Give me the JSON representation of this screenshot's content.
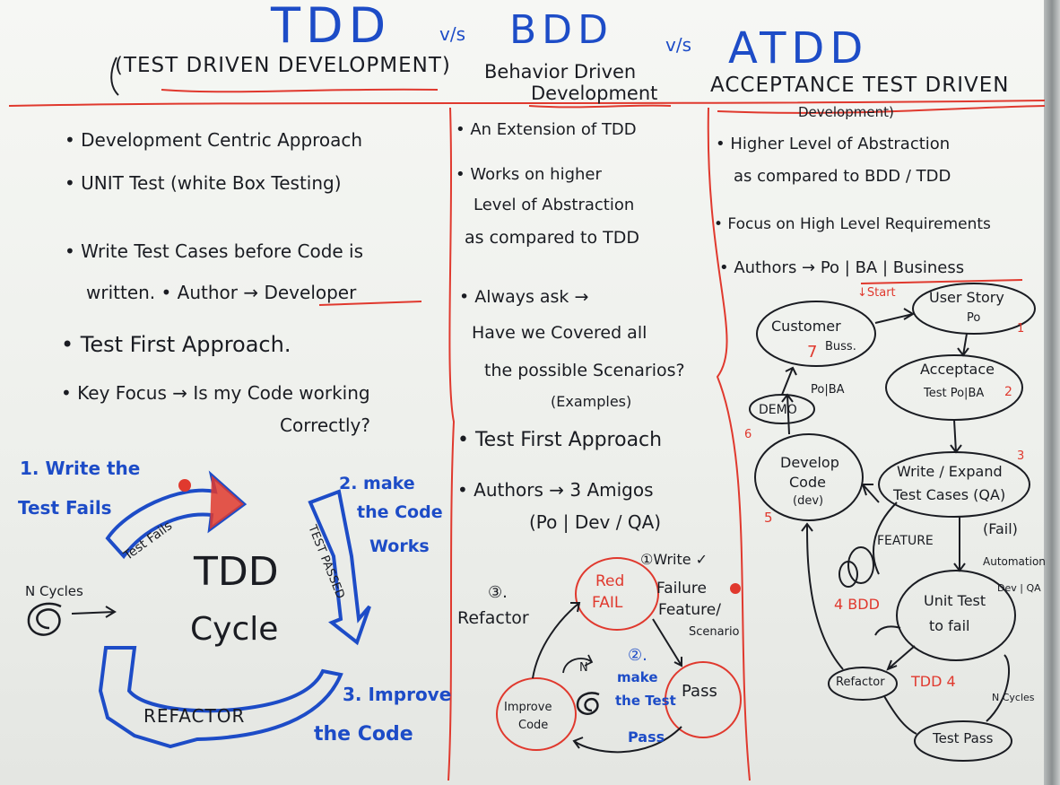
{
  "header": {
    "tdd": "TDD",
    "vs1": "v/s",
    "bdd": "BDD",
    "vs2": "v/s",
    "atdd": "ATDD",
    "tdd_full": "(TEST DRIVEN DEVELOPMENT)",
    "bdd_full_1": "Behavior Driven",
    "bdd_full_2": "Development",
    "atdd_full_1": "ACCEPTANCE TEST DRIVEN",
    "atdd_full_2": "Development)"
  },
  "tdd_col": {
    "bullets": [
      "• Development Centric Approach",
      "• UNIT Test (white Box Testing)",
      "• Write Test Cases before Code is",
      "written.  • Author → Developer",
      "• Test First Approach.",
      "• Key Focus → Is my Code working",
      "Correctly?"
    ],
    "cycle": {
      "step1_a": "1. Write the",
      "step1_b": "Test Fails",
      "step2_a": "2. make",
      "step2_b": "the Code",
      "step2_c": "Works",
      "step3_a": "3. Improve",
      "step3_b": "the Code",
      "arrow1": "Test Fails",
      "arrow2": "TEST PASSED",
      "arrow3": "REFACTOR",
      "center_1": "TDD",
      "center_2": "Cycle",
      "n_cycles": "N Cycles"
    }
  },
  "bdd_col": {
    "bullets": [
      "• An Extension of TDD",
      "• Works on higher",
      "Level of Abstraction",
      "as compared to TDD",
      "• Always ask →",
      "Have we Covered all",
      "the possible Scenarios?",
      "(Examples)",
      "• Test First Approach",
      "• Authors → 3 Amigos",
      "(Po | Dev / QA)"
    ],
    "cycle": {
      "red_1": "Red",
      "red_2": "FAIL",
      "pass": "Pass",
      "improve_1": "Improve",
      "improve_2": "Code",
      "step1_a": "①Write ✓",
      "step1_b": "Failure",
      "step1_c": "Feature/",
      "step1_d": "Scenario",
      "step2_num": "②.",
      "step2_a": "make",
      "step2_b": "the Test",
      "step2_c": "Pass",
      "step3_num": "③.",
      "step3_a": "Refactor",
      "loop": "N"
    }
  },
  "atdd_col": {
    "bullets": [
      "• Higher Level of Abstraction",
      "as compared to BDD / TDD",
      "• Focus on High Level Requirements",
      "• Authors → Po | BA | Business"
    ],
    "flow": {
      "start": "↓Start",
      "customer_1": "Customer",
      "customer_2": "Buss.",
      "customer_num": "7",
      "userstory_1": "User Story",
      "userstory_2": "Po",
      "userstory_num": "1",
      "acceptance_1": "Acceptace",
      "acceptance_2": "Test Po|BA",
      "acceptance_num": "2",
      "demo": "DEMO",
      "demo_tag": "Po|BA",
      "demo_num": "6",
      "develop_1": "Develop",
      "develop_2": "Code",
      "develop_3": "(dev)",
      "develop_num": "5",
      "write_1": "Write / Expand",
      "write_2": "Test Cases (QA)",
      "write_num": "3",
      "fail": "(Fail)",
      "feature": "FEATURE",
      "bdd4": "4 BDD",
      "automation_1": "Automation",
      "automation_2": "Dev | QA",
      "unit_1": "Unit Test",
      "unit_2": "to fail",
      "refactor": "Refactor",
      "tdd4": "TDD 4",
      "ncycles": "N Cycles",
      "testpass": "Test Pass"
    }
  },
  "colors": {
    "ink_black": "#1a1c22",
    "ink_blue": "#1d4cc7",
    "ink_red": "#e0392e",
    "board": "#f2f3f0"
  }
}
